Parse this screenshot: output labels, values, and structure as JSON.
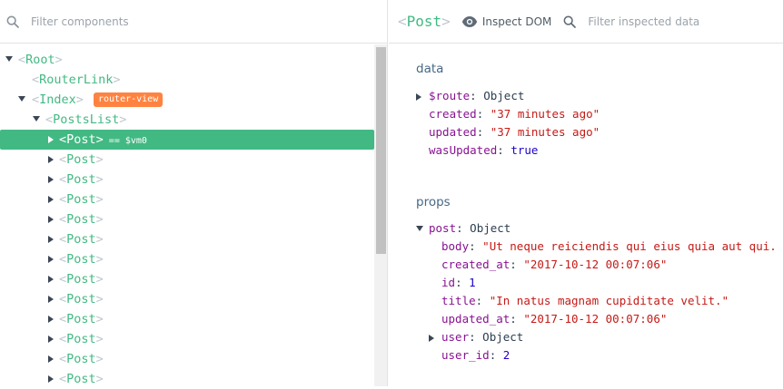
{
  "components": {
    "filter_placeholder": "Filter components",
    "tree": [
      {
        "name": "Root",
        "expanded": true
      },
      {
        "name": "RouterLink"
      },
      {
        "name": "Index",
        "expanded": true,
        "badge": "router-view"
      },
      {
        "name": "PostsList",
        "expanded": true
      },
      {
        "name": "Post",
        "selected": true,
        "vm": "== $vm0"
      },
      {
        "name": "Post"
      },
      {
        "name": "Post"
      },
      {
        "name": "Post"
      },
      {
        "name": "Post"
      },
      {
        "name": "Post"
      },
      {
        "name": "Post"
      },
      {
        "name": "Post"
      },
      {
        "name": "Post"
      },
      {
        "name": "Post"
      },
      {
        "name": "Post"
      },
      {
        "name": "Post"
      },
      {
        "name": "Post"
      }
    ]
  },
  "inspector": {
    "component_name": "Post",
    "inspect_dom_label": "Inspect DOM",
    "filter_placeholder": "Filter inspected data",
    "sections": {
      "data": {
        "title": "data",
        "items": [
          {
            "key": "$route",
            "value": "Object",
            "type": "object"
          },
          {
            "key": "created",
            "value": "\"37 minutes ago\"",
            "type": "string"
          },
          {
            "key": "updated",
            "value": "\"37 minutes ago\"",
            "type": "string"
          },
          {
            "key": "wasUpdated",
            "value": "true",
            "type": "bool"
          }
        ]
      },
      "props": {
        "title": "props",
        "items": [
          {
            "key": "post",
            "value": "Object",
            "type": "object"
          },
          {
            "key": "body",
            "value": "\"Ut neque reiciendis qui eius quia aut qui. Et",
            "type": "string"
          },
          {
            "key": "created_at",
            "value": "\"2017-10-12 00:07:06\"",
            "type": "string"
          },
          {
            "key": "id",
            "value": "1",
            "type": "number"
          },
          {
            "key": "title",
            "value": "\"In natus magnam cupiditate velit.\"",
            "type": "string"
          },
          {
            "key": "updated_at",
            "value": "\"2017-10-12 00:07:06\"",
            "type": "string"
          },
          {
            "key": "user",
            "value": "Object",
            "type": "object"
          },
          {
            "key": "user_id",
            "value": "2",
            "type": "number"
          }
        ]
      }
    }
  },
  "colors": {
    "vue_green": "#42b983",
    "badge_orange": "#ff8340"
  },
  "icons": [
    "search-icon",
    "eye-icon",
    "expand-arrow-icon",
    "collapse-arrow-icon"
  ]
}
